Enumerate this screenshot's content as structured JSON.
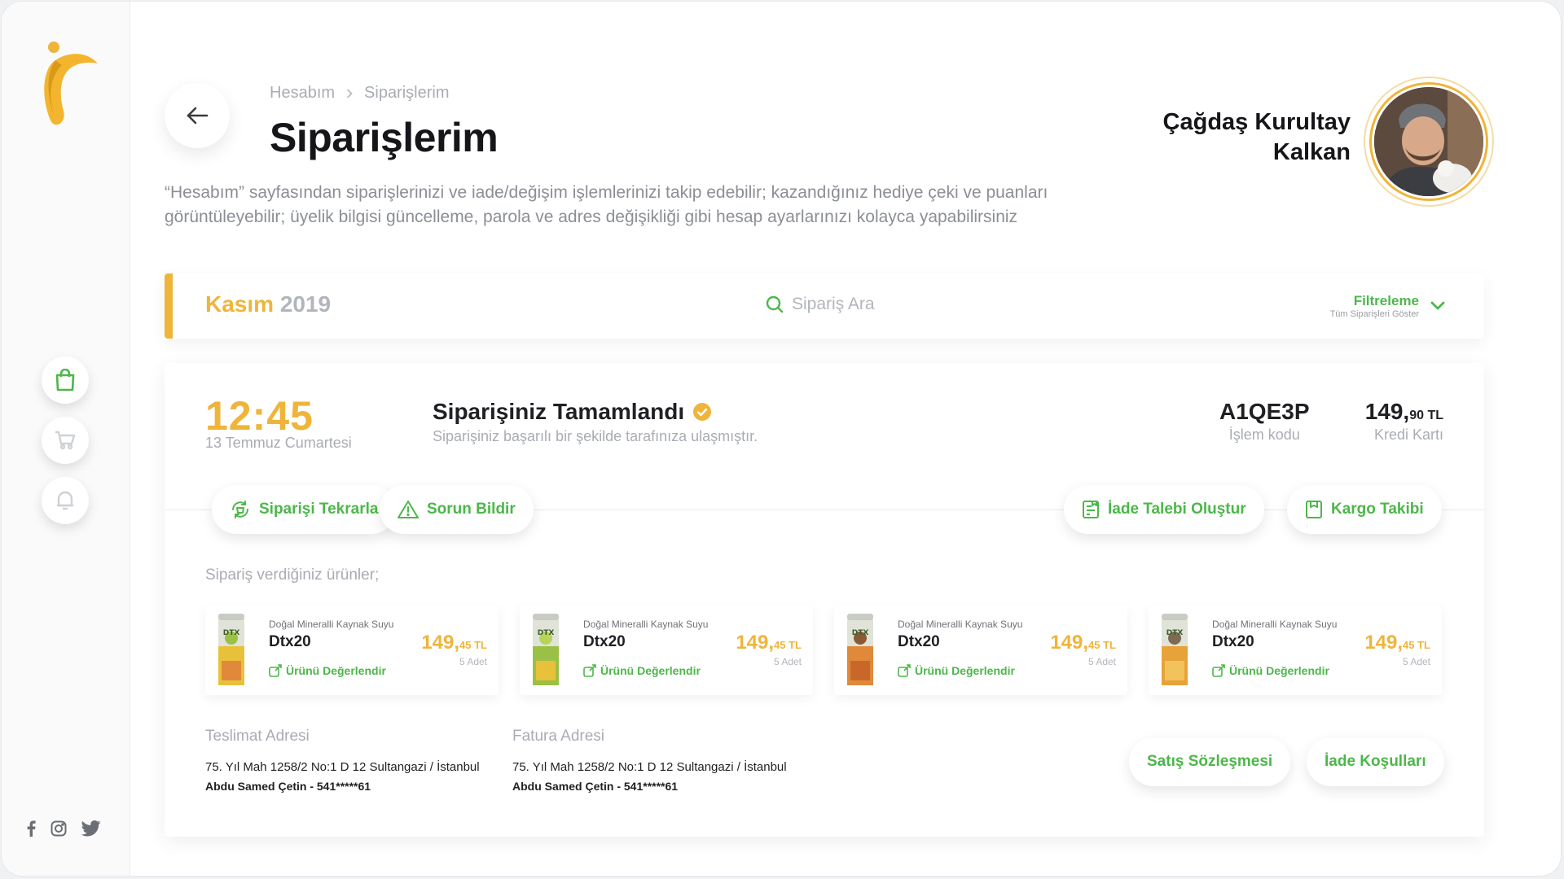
{
  "breadcrumb": {
    "items": [
      "Hesabım",
      "Siparişlerim"
    ]
  },
  "page_title": "Siparişlerim",
  "intro_text": "“Hesabım” sayfasından siparişlerinizi ve iade/değişim işlemlerinizi takip edebilir; kazandığınız hediye çeki ve puanları görüntüleyebilir; üyelik bilgisi güncelleme, parola ve adres değişikliği gibi hesap ayarlarınızı kolayca yapabilirsiniz",
  "user": {
    "name_line1": "Çağdaş Kurultay",
    "name_line2": "Kalkan"
  },
  "month_bar": {
    "month": "Kasım",
    "year": "2019",
    "search_placeholder": "Sipariş Ara",
    "filter_label": "Filtreleme",
    "filter_sub": "Tüm Siparişleri Göster"
  },
  "order": {
    "time": "12:45",
    "date": "13 Temmuz Cumartesi",
    "status_title": "Siparişiniz Tamamlandı",
    "status_sub": "Siparişiniz başarılı bir şekilde tarafınıza ulaşmıştır.",
    "code": "A1QE3P",
    "code_label": "İşlem kodu",
    "price_main": "149,",
    "price_frac": "90 TL",
    "payment": "Kredi Kartı",
    "actions": {
      "repeat": "Siparişi Tekrarla",
      "report": "Sorun Bildir",
      "return": "İade Talebi Oluştur",
      "cargo": "Kargo Takibi"
    },
    "products_title": "Sipariş verdiğiniz ürünler;",
    "products": [
      {
        "category": "Doğal Mineralli Kaynak Suyu",
        "name": "Dtx20",
        "price_main": "149,",
        "price_frac": "45 TL",
        "qty": "5 Adet",
        "rate": "Ürünü Değerlendir"
      },
      {
        "category": "Doğal Mineralli Kaynak Suyu",
        "name": "Dtx20",
        "price_main": "149,",
        "price_frac": "45 TL",
        "qty": "5 Adet",
        "rate": "Ürünü Değerlendir"
      },
      {
        "category": "Doğal Mineralli Kaynak Suyu",
        "name": "Dtx20",
        "price_main": "149,",
        "price_frac": "45 TL",
        "qty": "5 Adet",
        "rate": "Ürünü Değerlendir"
      },
      {
        "category": "Doğal Mineralli Kaynak Suyu",
        "name": "Dtx20",
        "price_main": "149,",
        "price_frac": "45 TL",
        "qty": "5 Adet",
        "rate": "Ürünü Değerlendir"
      }
    ],
    "delivery": {
      "title": "Teslimat Adresi",
      "line": "75. Yıl Mah 1258/2 No:1 D 12 Sultangazi / İstanbul",
      "name": "Abdu Samed Çetin - 541*****61"
    },
    "invoice": {
      "title": "Fatura Adresi",
      "line": "75. Yıl Mah 1258/2 No:1 D 12 Sultangazi / İstanbul",
      "name": "Abdu Samed Çetin - 541*****61"
    },
    "footer_buttons": {
      "contract": "Satış Sözleşmesi",
      "return_terms": "İade Koşulları"
    }
  },
  "colors": {
    "accent": "#efb43a",
    "green": "#4cb749",
    "muted": "#a9acb3"
  }
}
